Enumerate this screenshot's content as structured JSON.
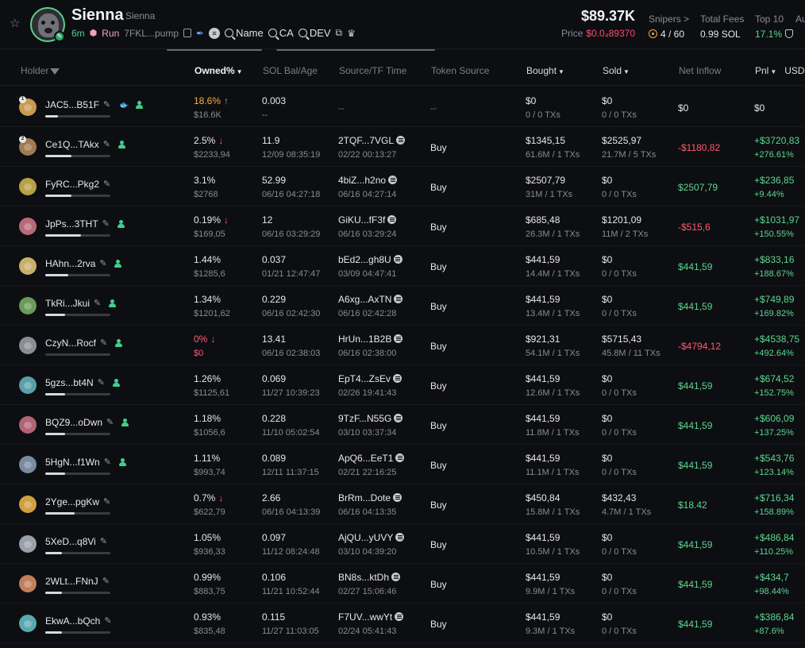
{
  "token": {
    "name": "Sienna",
    "subname": "Sienna",
    "age": "6m",
    "run_label": "Run",
    "address": "7FKL...pump",
    "links": {
      "name": "Name",
      "ca": "CA",
      "dev": "DEV"
    },
    "market_cap": "$89.37K",
    "price_label": "Price",
    "price": "$0.0₄89370",
    "snipers_label": "Snipers >",
    "snipers": "4 / 60",
    "fees_label": "Total Fees",
    "fees": "0.99 SOL",
    "top10_label": "Top 10",
    "top10": "17.1%",
    "au_label": "Au"
  },
  "columns": {
    "holder": "Holder",
    "owned": "Owned%",
    "sol": "SOL Bal/Age",
    "source_time": "Source/TF Time",
    "token_source": "Token Source",
    "bought": "Bought",
    "sold": "Sold",
    "net": "Net Inflow",
    "pnl": "Pnl",
    "usd": "USD"
  },
  "colors": {
    "accent_green": "#5cd68f",
    "accent_red": "#ff5a72",
    "accent_orange": "#f5b042"
  },
  "rows": [
    {
      "rank": "1",
      "holder": "JAC5...B51F",
      "bar": 0.186,
      "fish": true,
      "pct": "18.6%",
      "pct_color": "orange",
      "dir": "up",
      "usd": "$16.6K",
      "sol": "0.003",
      "age": "--",
      "src": "--",
      "src_time": "",
      "src_icon": false,
      "token_source": "--",
      "bought": "$0",
      "bought_sub": "0 / 0 TXs",
      "sold": "$0",
      "sold_sub": "0 / 0 TXs",
      "net": "$0",
      "net_color": "white",
      "pnl": "$0",
      "pnl_pct": "",
      "pnl_color": "white",
      "avatar": "#c99a52"
    },
    {
      "rank": "2",
      "holder": "Ce1Q...TAkx",
      "bar": 0.4,
      "fish": false,
      "pct": "2.5%",
      "pct_color": "white",
      "dir": "down",
      "usd": "$2233,94",
      "sol": "11.9",
      "age": "12/09 08:35:19",
      "src": "2TQF...7VGL",
      "src_time": "02/22 00:13:27",
      "src_icon": true,
      "token_source": "Buy",
      "bought": "$1345,15",
      "bought_sub": "61.6M / 1 TXs",
      "sold": "$2525,97",
      "sold_sub": "21.7M / 5 TXs",
      "net": "-$1180,82",
      "net_color": "red",
      "pnl": "+$3720,83",
      "pnl_pct": "+276.61%",
      "pnl_color": "green",
      "avatar": "#a07a52"
    },
    {
      "rank": "",
      "holder": "FyRC...Pkg2",
      "bar": 0.4,
      "fish": false,
      "pct": "3.1%",
      "pct_color": "white",
      "dir": "",
      "usd": "$2768",
      "sol": "52.99",
      "age": "06/16 04:27:18",
      "src": "4biZ...h2no",
      "src_time": "06/16 04:27:14",
      "src_icon": true,
      "token_source": "Buy",
      "bought": "$2507,79",
      "bought_sub": "31M / 1 TXs",
      "sold": "$0",
      "sold_sub": "0 / 0 TXs",
      "net": "$2507,79",
      "net_color": "green",
      "pnl": "+$236,85",
      "pnl_pct": "+9.44%",
      "pnl_color": "green",
      "avatar": "#b9a046"
    },
    {
      "rank": "",
      "holder": "JpPs...3THT",
      "bar": 0.55,
      "fish": false,
      "pct": "0.19%",
      "pct_color": "white",
      "dir": "down",
      "usd": "$169,05",
      "sol": "12",
      "age": "06/16 03:29:29",
      "src": "GiKU...fF3f",
      "src_time": "06/16 03:29:24",
      "src_icon": true,
      "token_source": "Buy",
      "bought": "$685,48",
      "bought_sub": "26.3M / 1 TXs",
      "sold": "$1201,09",
      "sold_sub": "11M / 2 TXs",
      "net": "-$515,6",
      "net_color": "red",
      "pnl": "+$1031,97",
      "pnl_pct": "+150.55%",
      "pnl_color": "green",
      "avatar": "#b86a78"
    },
    {
      "rank": "",
      "holder": "HAhn...2rva",
      "bar": 0.35,
      "fish": false,
      "pct": "1.44%",
      "pct_color": "white",
      "dir": "",
      "usd": "$1285,6",
      "sol": "0.037",
      "age": "01/21 12:47:47",
      "src": "bEd2...gh8U",
      "src_time": "03/09 04:47:41",
      "src_icon": true,
      "token_source": "Buy",
      "bought": "$441,59",
      "bought_sub": "14.4M / 1 TXs",
      "sold": "$0",
      "sold_sub": "0 / 0 TXs",
      "net": "$441,59",
      "net_color": "green",
      "pnl": "+$833,16",
      "pnl_pct": "+188.67%",
      "pnl_color": "green",
      "avatar": "#c8b06a"
    },
    {
      "rank": "",
      "holder": "TkRi...Jkui",
      "bar": 0.3,
      "fish": false,
      "pct": "1.34%",
      "pct_color": "white",
      "dir": "",
      "usd": "$1201,62",
      "sol": "0.229",
      "age": "06/16 02:42:30",
      "src": "A6xg...AxTN",
      "src_time": "06/16 02:42:28",
      "src_icon": true,
      "token_source": "Buy",
      "bought": "$441,59",
      "bought_sub": "13.4M / 1 TXs",
      "sold": "$0",
      "sold_sub": "0 / 0 TXs",
      "net": "$441,59",
      "net_color": "green",
      "pnl": "+$749,89",
      "pnl_pct": "+169.82%",
      "pnl_color": "green",
      "avatar": "#6a9a58"
    },
    {
      "rank": "",
      "holder": "CzyN...Rocf",
      "bar": 0.0,
      "fish": false,
      "pct": "0%",
      "pct_color": "red",
      "dir": "down",
      "usd": "$0",
      "usd_color": "red",
      "sol": "13.41",
      "age": "06/16 02:38:03",
      "src": "HrUn...1B2B",
      "src_time": "06/16 02:38:00",
      "src_icon": true,
      "token_source": "Buy",
      "bought": "$921,31",
      "bought_sub": "54.1M / 1 TXs",
      "sold": "$5715,43",
      "sold_sub": "45.8M / 11 TXs",
      "net": "-$4794,12",
      "net_color": "red",
      "pnl": "+$4538,75",
      "pnl_pct": "+492.64%",
      "pnl_color": "green",
      "avatar": "#8a8c96"
    },
    {
      "rank": "",
      "holder": "5gzs...bt4N",
      "bar": 0.3,
      "fish": false,
      "pct": "1.26%",
      "pct_color": "white",
      "dir": "",
      "usd": "$1125,61",
      "sol": "0.069",
      "age": "11/27 10:39:23",
      "src": "EpT4...ZsEv",
      "src_time": "02/26 19:41:43",
      "src_icon": true,
      "token_source": "Buy",
      "bought": "$441,59",
      "bought_sub": "12.6M / 1 TXs",
      "sold": "$0",
      "sold_sub": "0 / 0 TXs",
      "net": "$441,59",
      "net_color": "green",
      "pnl": "+$674,52",
      "pnl_pct": "+152.75%",
      "pnl_color": "green",
      "avatar": "#5aa0a8"
    },
    {
      "rank": "",
      "holder": "BQZ9...oDwn",
      "bar": 0.3,
      "fish": false,
      "pct": "1.18%",
      "pct_color": "white",
      "dir": "",
      "usd": "$1056,6",
      "sol": "0.228",
      "age": "11/10 05:02:54",
      "src": "9TzF...N55G",
      "src_time": "03/10 03:37:34",
      "src_icon": true,
      "token_source": "Buy",
      "bought": "$441,59",
      "bought_sub": "11.8M / 1 TXs",
      "sold": "$0",
      "sold_sub": "0 / 0 TXs",
      "net": "$441,59",
      "net_color": "green",
      "pnl": "+$606,09",
      "pnl_pct": "+137.25%",
      "pnl_color": "green",
      "avatar": "#b06474"
    },
    {
      "rank": "",
      "holder": "5HgN...f1Wn",
      "bar": 0.3,
      "fish": false,
      "pct": "1.11%",
      "pct_color": "white",
      "dir": "",
      "usd": "$993,74",
      "sol": "0.089",
      "age": "12/11 11:37:15",
      "src": "ApQ6...EeT1",
      "src_time": "02/21 22:16:25",
      "src_icon": true,
      "token_source": "Buy",
      "bought": "$441,59",
      "bought_sub": "11.1M / 1 TXs",
      "sold": "$0",
      "sold_sub": "0 / 0 TXs",
      "net": "$441,59",
      "net_color": "green",
      "pnl": "+$543,76",
      "pnl_pct": "+123.14%",
      "pnl_color": "green",
      "avatar": "#7a8aa0"
    },
    {
      "rank": "",
      "holder": "2Yge...pgKw",
      "bar": 0.45,
      "fish": false,
      "pct": "0.7%",
      "pct_color": "white",
      "dir": "down",
      "usd": "$622,79",
      "sol": "2.66",
      "age": "06/16 04:13:39",
      "src": "BrRm...Dote",
      "src_time": "06/16 04:13:35",
      "src_icon": true,
      "token_source": "Buy",
      "bought": "$450,84",
      "bought_sub": "15.8M / 1 TXs",
      "sold": "$432,43",
      "sold_sub": "4.7M / 1 TXs",
      "net": "$18.42",
      "net_color": "green",
      "pnl": "+$716,34",
      "pnl_pct": "+158.89%",
      "pnl_color": "green",
      "avatar": "#d0a040"
    },
    {
      "rank": "",
      "holder": "5XeD...q8Vi",
      "bar": 0.25,
      "fish": false,
      "pct": "1.05%",
      "pct_color": "white",
      "dir": "",
      "usd": "$936,33",
      "sol": "0.097",
      "age": "11/12 08:24:48",
      "src": "AjQU...yUVY",
      "src_time": "03/10 04:39:20",
      "src_icon": true,
      "token_source": "Buy",
      "bought": "$441,59",
      "bought_sub": "10.5M / 1 TXs",
      "sold": "$0",
      "sold_sub": "0 / 0 TXs",
      "net": "$441,59",
      "net_color": "green",
      "pnl": "+$486,84",
      "pnl_pct": "+110.25%",
      "pnl_color": "green",
      "avatar": "#9aa0aa"
    },
    {
      "rank": "",
      "holder": "2WLt...FNnJ",
      "bar": 0.25,
      "fish": false,
      "pct": "0.99%",
      "pct_color": "white",
      "dir": "",
      "usd": "$883,75",
      "sol": "0.106",
      "age": "11/21 10:52:44",
      "src": "BN8s...ktDh",
      "src_time": "02/27 15:06:46",
      "src_icon": true,
      "token_source": "Buy",
      "bought": "$441,59",
      "bought_sub": "9.9M / 1 TXs",
      "sold": "$0",
      "sold_sub": "0 / 0 TXs",
      "net": "$441,59",
      "net_color": "green",
      "pnl": "+$434,7",
      "pnl_pct": "+98.44%",
      "pnl_color": "green",
      "avatar": "#c0805a"
    },
    {
      "rank": "",
      "holder": "EkwA...bQch",
      "bar": 0.25,
      "fish": false,
      "pct": "0.93%",
      "pct_color": "white",
      "dir": "",
      "usd": "$835,48",
      "sol": "0.115",
      "age": "11/27 11:03:05",
      "src": "F7UV...wwYt",
      "src_time": "02/24 05:41:43",
      "src_icon": true,
      "token_source": "Buy",
      "bought": "$441,59",
      "bought_sub": "9.3M / 1 TXs",
      "sold": "$0",
      "sold_sub": "0 / 0 TXs",
      "net": "$441,59",
      "net_color": "green",
      "pnl": "+$386,84",
      "pnl_pct": "+87.6%",
      "pnl_color": "green",
      "avatar": "#5aa8b0"
    }
  ]
}
